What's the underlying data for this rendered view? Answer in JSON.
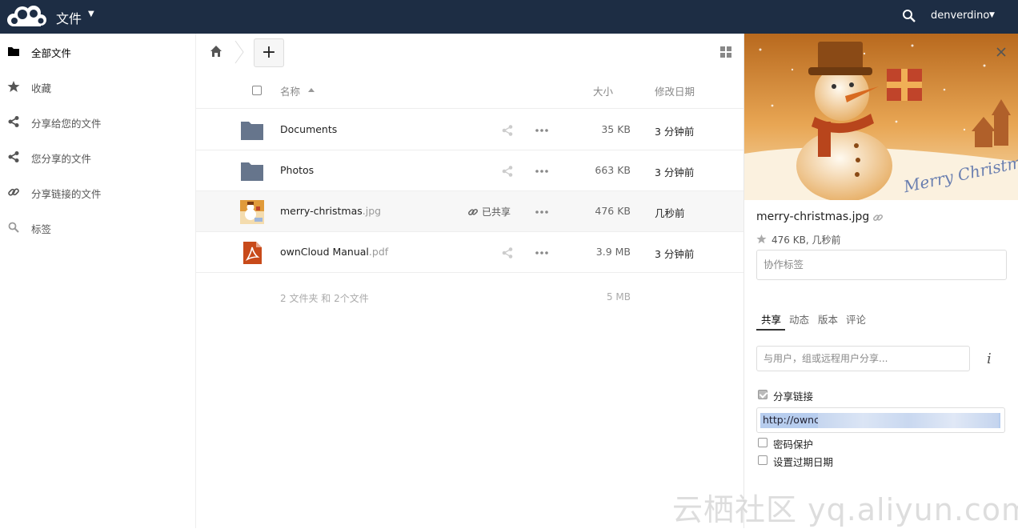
{
  "header": {
    "app_title": "文件",
    "user_name": "denverdino",
    "icons": {
      "logo": "owncloud-logo",
      "search": "search-icon"
    }
  },
  "sidebar": {
    "items": [
      {
        "label": "全部文件",
        "icon": "folder-icon",
        "active": true
      },
      {
        "label": "收藏",
        "icon": "star-icon"
      },
      {
        "label": "分享给您的文件",
        "icon": "share-icon"
      },
      {
        "label": "您分享的文件",
        "icon": "share-icon"
      },
      {
        "label": "分享链接的文件",
        "icon": "link-icon"
      },
      {
        "label": "标签",
        "icon": "tag-icon"
      }
    ]
  },
  "toolbar": {
    "new_label": "+"
  },
  "file_list": {
    "columns": {
      "name": "名称",
      "size": "大小",
      "modified": "修改日期"
    },
    "rows": [
      {
        "base": "Documents",
        "ext": "",
        "size": "35 KB",
        "modified": "3 分钟前",
        "type": "folder"
      },
      {
        "base": "Photos",
        "ext": "",
        "size": "663 KB",
        "modified": "3 分钟前",
        "type": "folder"
      },
      {
        "base": "merry-christmas",
        "ext": ".jpg",
        "size": "476 KB",
        "modified": "几秒前",
        "type": "image",
        "shared_label": "已共享"
      },
      {
        "base": "ownCloud Manual",
        "ext": ".pdf",
        "size": "3.9 MB",
        "modified": "3 分钟前",
        "type": "pdf"
      }
    ],
    "summary": {
      "text": "2 文件夹 和 2个文件",
      "size": "5 MB"
    }
  },
  "details": {
    "filename": "merry-christmas.jpg",
    "meta": "476 KB, 几秒前",
    "tags_placeholder": "协作标签",
    "tabs": [
      "共享",
      "动态",
      "版本",
      "评论"
    ],
    "share_placeholder": "与用户，组或远程用户分享...",
    "info_label": "i",
    "share_link_label": "分享链接",
    "share_link_value": "http://ownc",
    "password_label": "密码保护",
    "expiry_label": "设置过期日期",
    "preview_caption": "Merry Christmas"
  },
  "watermark": "云栖社区 yq.aliyun.com",
  "colors": {
    "header_bg": "#1d2d44",
    "folder": "#66758c",
    "selection": "#b7cdee"
  }
}
